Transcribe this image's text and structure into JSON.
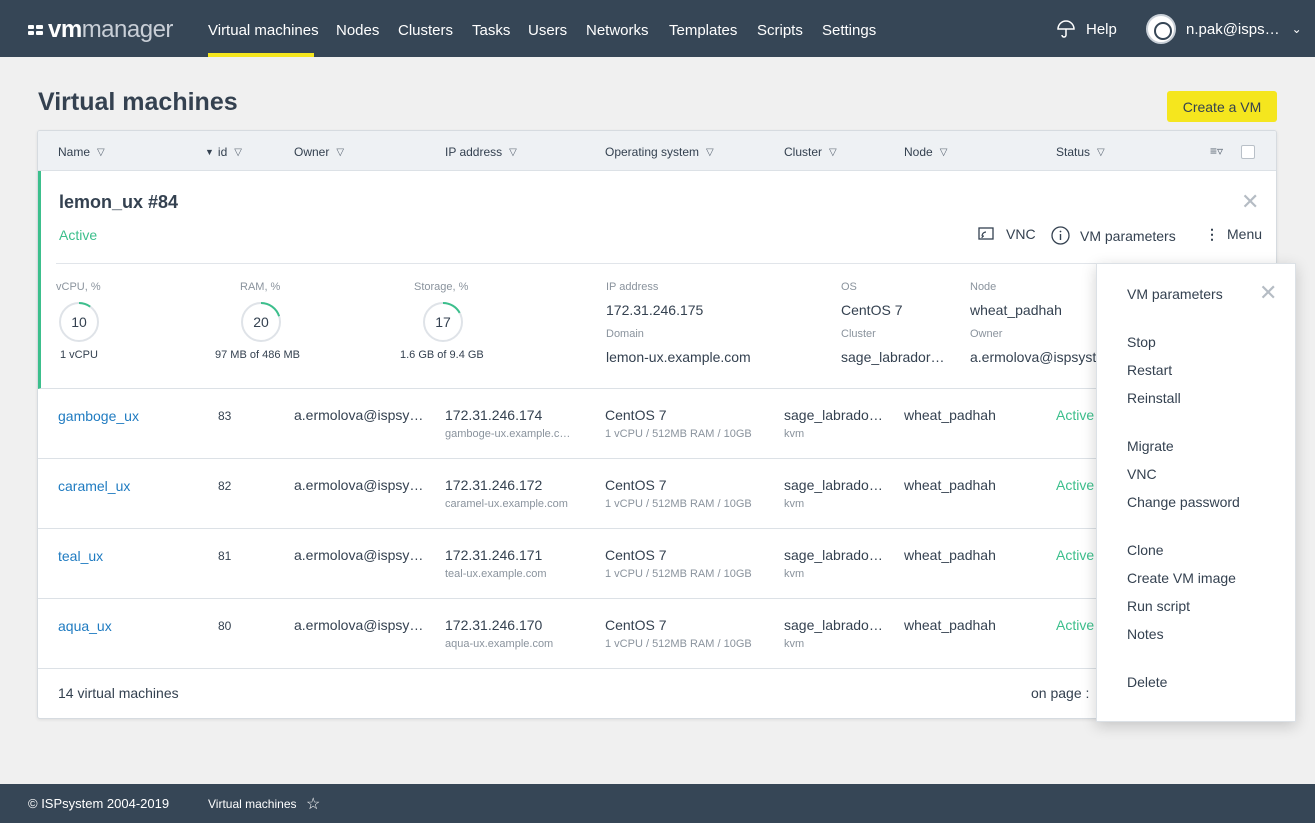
{
  "brand": {
    "part_a": "vm",
    "part_b": "manager"
  },
  "nav": {
    "items": [
      "Virtual machines",
      "Nodes",
      "Clusters",
      "Tasks",
      "Users",
      "Networks",
      "Templates",
      "Scripts",
      "Settings"
    ],
    "active": "Virtual machines",
    "help": "Help",
    "user": "n.pak@isps…"
  },
  "page": {
    "title": "Virtual machines",
    "create_button": "Create a VM"
  },
  "table": {
    "columns": [
      "Name",
      "id",
      "Owner",
      "IP address",
      "Operating system",
      "Cluster",
      "Node",
      "Status"
    ],
    "sort_indicator": "▼",
    "expanded": {
      "name": "lemon_ux  #84",
      "status": "Active",
      "actions": {
        "vnc": "VNC",
        "params": "VM parameters",
        "menu": "Menu"
      },
      "metrics": [
        {
          "label": "vCPU, %",
          "value": "10",
          "fraction": 0.1,
          "sub": "1 vCPU"
        },
        {
          "label": "RAM, %",
          "value": "20",
          "fraction": 0.2,
          "sub": "97 MB of 486 MB"
        },
        {
          "label": "Storage, %",
          "value": "17",
          "fraction": 0.17,
          "sub": "1.6 GB of 9.4 GB"
        }
      ],
      "info": {
        "ip_label": "IP address",
        "ip": "172.31.246.175",
        "domain_label": "Domain",
        "domain": "lemon-ux.example.com",
        "os_label": "OS",
        "os": "CentOS 7",
        "cluster_label": "Cluster",
        "cluster": "sage_labrador…",
        "node_label": "Node",
        "node": "wheat_padhah",
        "owner_label": "Owner",
        "owner": "a.ermolova@ispsyst"
      }
    },
    "rows": [
      {
        "name": "gamboge_ux",
        "id": "83",
        "owner": "a.ermolova@ispsy…",
        "ip": "172.31.246.174",
        "domain": "gamboge-ux.example.c…",
        "os": "CentOS 7",
        "os_sub": "1 vCPU / 512MB RAM / 10GB",
        "cluster": "sage_labrado…",
        "cluster_sub": "kvm",
        "node": "wheat_padhah",
        "status": "Active"
      },
      {
        "name": "caramel_ux",
        "id": "82",
        "owner": "a.ermolova@ispsy…",
        "ip": "172.31.246.172",
        "domain": "caramel-ux.example.com",
        "os": "CentOS 7",
        "os_sub": "1 vCPU / 512MB RAM / 10GB",
        "cluster": "sage_labrado…",
        "cluster_sub": "kvm",
        "node": "wheat_padhah",
        "status": "Active"
      },
      {
        "name": "teal_ux",
        "id": "81",
        "owner": "a.ermolova@ispsy…",
        "ip": "172.31.246.171",
        "domain": "teal-ux.example.com",
        "os": "CentOS 7",
        "os_sub": "1 vCPU / 512MB RAM / 10GB",
        "cluster": "sage_labrado…",
        "cluster_sub": "kvm",
        "node": "wheat_padhah",
        "status": "Active"
      },
      {
        "name": "aqua_ux",
        "id": "80",
        "owner": "a.ermolova@ispsy…",
        "ip": "172.31.246.170",
        "domain": "aqua-ux.example.com",
        "os": "CentOS 7",
        "os_sub": "1 vCPU / 512MB RAM / 10GB",
        "cluster": "sage_labrado…",
        "cluster_sub": "kvm",
        "node": "wheat_padhah",
        "status": "Active"
      }
    ],
    "footer": {
      "count": "14 virtual machines",
      "on_page": "on page :"
    }
  },
  "menu": {
    "items": [
      "VM parameters",
      "Stop",
      "Restart",
      "Reinstall",
      "Migrate",
      "VNC",
      "Change password",
      "Clone",
      "Create VM image",
      "Run script",
      "Notes",
      "Delete"
    ]
  },
  "footer": {
    "copyright": "© ISPsystem 2004-2019",
    "crumb": "Virtual machines"
  },
  "colors": {
    "topbar": "#364656",
    "accent": "#f5e61e",
    "active": "#3cbf8c",
    "link": "#1f7bc1"
  }
}
